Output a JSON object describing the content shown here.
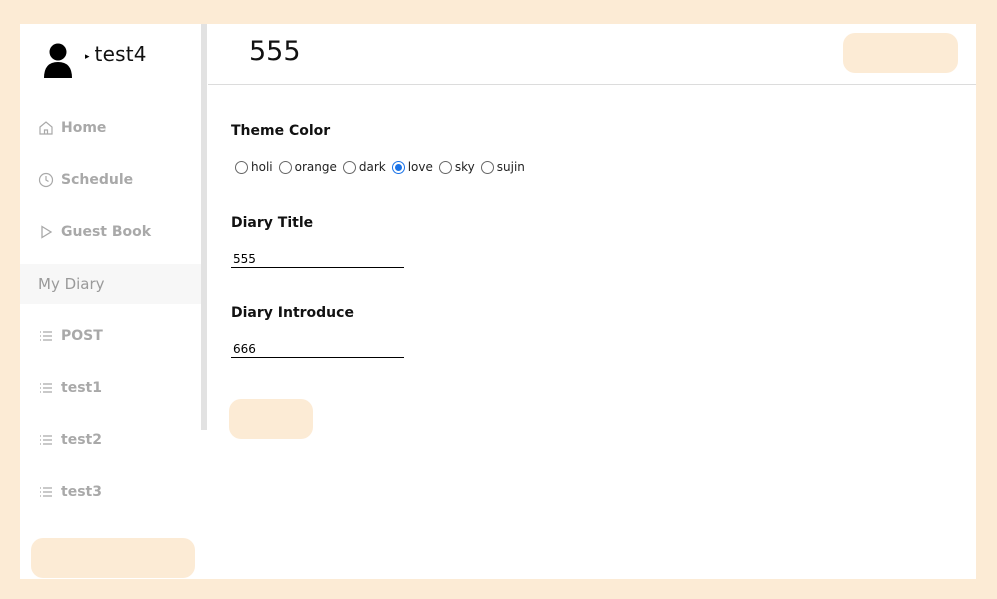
{
  "profile": {
    "toggle_glyph": "▸",
    "username": "test4",
    "avatar_icon": "user-avatar-icon"
  },
  "sidebar": {
    "items": [
      {
        "label": "Home",
        "icon": "home-icon"
      },
      {
        "label": "Schedule",
        "icon": "clock-icon"
      },
      {
        "label": "Guest Book",
        "icon": "play-icon"
      },
      {
        "label": "My Diary",
        "icon": "",
        "active": true
      },
      {
        "label": "POST",
        "icon": "list-icon"
      },
      {
        "label": "test1",
        "icon": "list-icon"
      },
      {
        "label": "test2",
        "icon": "list-icon"
      },
      {
        "label": "test3",
        "icon": "list-icon"
      }
    ]
  },
  "header": {
    "title": "555"
  },
  "settings": {
    "theme_label": "Theme Color",
    "theme_options": [
      "holi",
      "orange",
      "dark",
      "love",
      "sky",
      "sujin"
    ],
    "theme_selected": "love",
    "title_label": "Diary Title",
    "title_value": "555",
    "intro_label": "Diary Introduce",
    "intro_value": "666"
  },
  "colors": {
    "background": "#fcebd5",
    "accent": "#1a73e8",
    "muted_text": "#a9a9a9"
  }
}
